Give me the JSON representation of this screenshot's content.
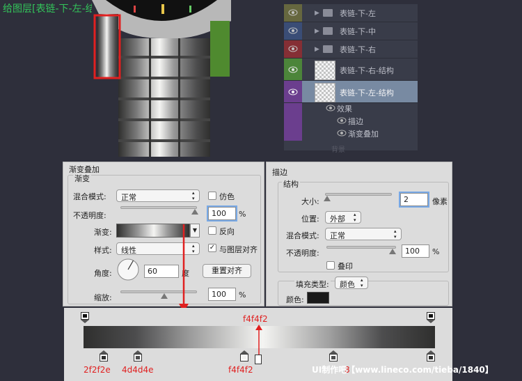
{
  "caption": "给图层[表链-下-左-结构]添加描边、渐变叠加",
  "layers_panel": {
    "rows": [
      {
        "label": "表链-下-左",
        "kind": "folder",
        "color": "#6a6a40"
      },
      {
        "label": "表链-下-中",
        "kind": "folder",
        "color": "#3b4f7a"
      },
      {
        "label": "表链-下-右",
        "kind": "folder",
        "color": "#8a2f35"
      },
      {
        "label": "表链-下-右-结构",
        "kind": "layer",
        "color": "#4e8a3a"
      },
      {
        "label": "表链-下-左-结构",
        "kind": "layer",
        "color": "#6f3f93",
        "selected": true
      }
    ],
    "effects_label": "效果",
    "effect_stroke": "描边",
    "effect_gradient": "渐变叠加",
    "faded_label": "背景"
  },
  "gradient_overlay": {
    "title": "渐变叠加",
    "group_title": "渐变",
    "blend_mode_label": "混合模式:",
    "blend_mode_value": "正常",
    "dither_label": "仿色",
    "opacity_label": "不透明度:",
    "opacity_value": "100",
    "percent": "%",
    "gradient_label": "渐变:",
    "reverse_label": "反向",
    "style_label": "样式:",
    "style_value": "线性",
    "align_label": "与图层对齐",
    "angle_label": "角度:",
    "angle_value": "60",
    "degree": "度",
    "reset_button": "重置对齐",
    "scale_label": "缩放:",
    "scale_value": "100"
  },
  "stroke": {
    "title": "描边",
    "group_title": "结构",
    "size_label": "大小:",
    "size_value": "2",
    "size_unit": "像素",
    "position_label": "位置:",
    "position_value": "外部",
    "blend_mode_label": "混合模式:",
    "blend_mode_value": "正常",
    "opacity_label": "不透明度:",
    "opacity_value": "100",
    "percent": "%",
    "emboss_label": "叠印",
    "fill_type_label": "填充类型:",
    "fill_type_value": "颜色",
    "color_label": "颜色:"
  },
  "gradient_editor": {
    "top_label": "f4f4f2",
    "stop_labels": [
      "2f2f2e",
      "4d4d4e",
      "f4f4f2",
      "8"
    ],
    "watermark": "UI制作吧【www.lineco.com/tieba/1840】"
  },
  "colors": {
    "accent_green": "#33c45a",
    "annotation_red": "#e02020",
    "stroke_color": "#1a1a1a"
  }
}
